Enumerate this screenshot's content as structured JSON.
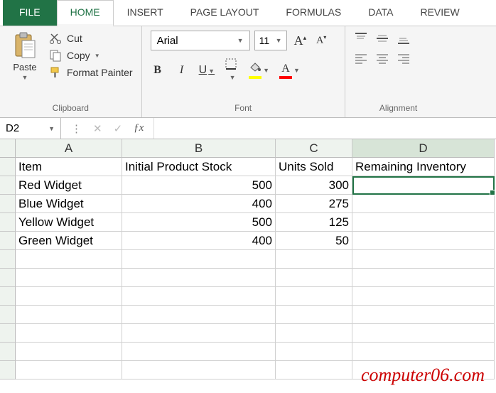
{
  "tabs": {
    "file": "FILE",
    "home": "HOME",
    "insert": "INSERT",
    "page_layout": "PAGE LAYOUT",
    "formulas": "FORMULAS",
    "data": "DATA",
    "review": "REVIEW"
  },
  "ribbon": {
    "clipboard": {
      "paste": "Paste",
      "cut": "Cut",
      "copy": "Copy",
      "format_painter": "Format Painter",
      "group_label": "Clipboard"
    },
    "font": {
      "name": "Arial",
      "size": "11",
      "group_label": "Font"
    },
    "alignment": {
      "group_label": "Alignment"
    }
  },
  "formula_bar": {
    "name_box": "D2",
    "formula": ""
  },
  "columns": [
    "A",
    "B",
    "C",
    "D"
  ],
  "rows": [
    {
      "a": "Item",
      "b": "Initial Product Stock",
      "c": "Units Sold",
      "d": "Remaining Inventory"
    },
    {
      "a": "Red Widget",
      "b": "500",
      "c": "300",
      "d": ""
    },
    {
      "a": "Blue Widget",
      "b": "400",
      "c": "275",
      "d": ""
    },
    {
      "a": "Yellow Widget",
      "b": "500",
      "c": "125",
      "d": ""
    },
    {
      "a": "Green Widget",
      "b": "400",
      "c": "50",
      "d": ""
    }
  ],
  "selected_cell": "D2",
  "watermark": "computer06.com"
}
